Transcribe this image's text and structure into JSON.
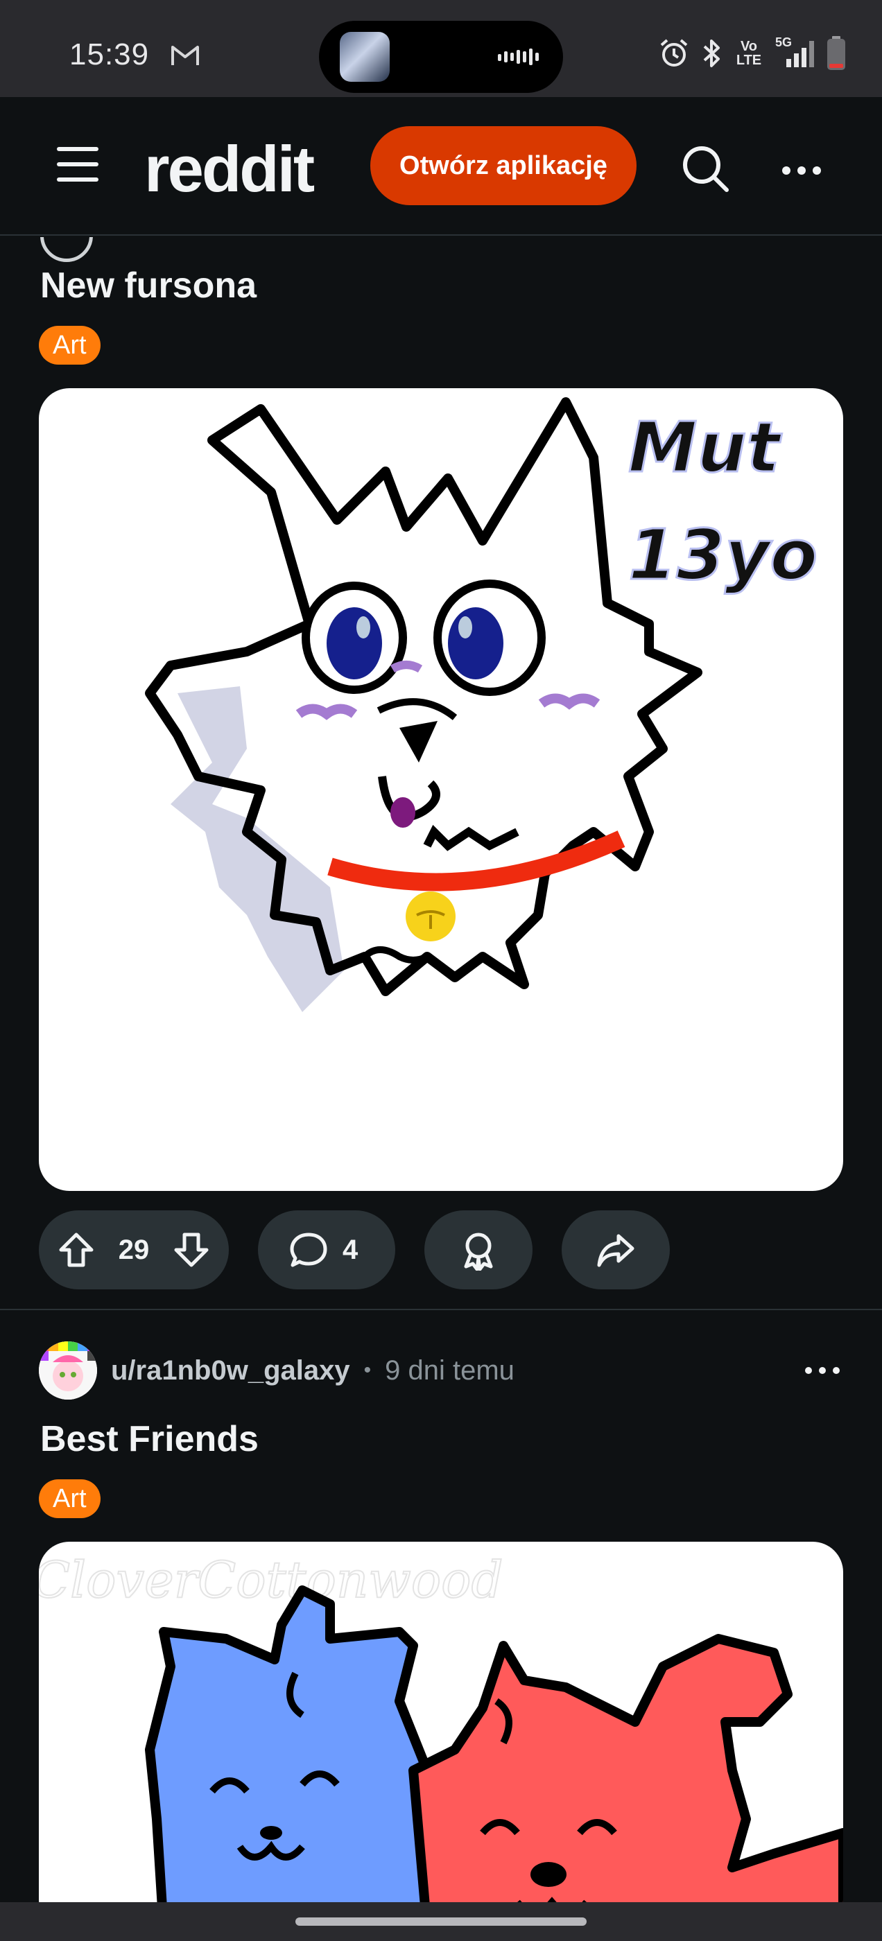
{
  "status_bar": {
    "time": "15:39",
    "network_label": "5G",
    "volte_label": "Vo LTE",
    "icons": [
      "gmail-icon",
      "alarm-icon",
      "bluetooth-icon",
      "volte-icon",
      "signal-icon",
      "battery-icon",
      "audio-waveform-icon"
    ]
  },
  "header": {
    "logo": "reddit",
    "open_app_label": "Otwórz aplikację",
    "icons": [
      "menu-icon",
      "search-icon",
      "more-icon"
    ]
  },
  "posts": [
    {
      "title": "New fursona",
      "flair": "Art",
      "image_text": [
        "Mut",
        "13yo"
      ],
      "score": "29",
      "comments": "4"
    },
    {
      "author": "u/ra1nb0w_galaxy",
      "age": "9 dni temu",
      "title": "Best Friends",
      "flair": "Art",
      "image_text": [
        "CloverCottonwood"
      ]
    }
  ],
  "colors": {
    "background": "#0e1113",
    "accent": "#d93900",
    "flair": "#ff7c0a",
    "pill": "#2a3236"
  }
}
